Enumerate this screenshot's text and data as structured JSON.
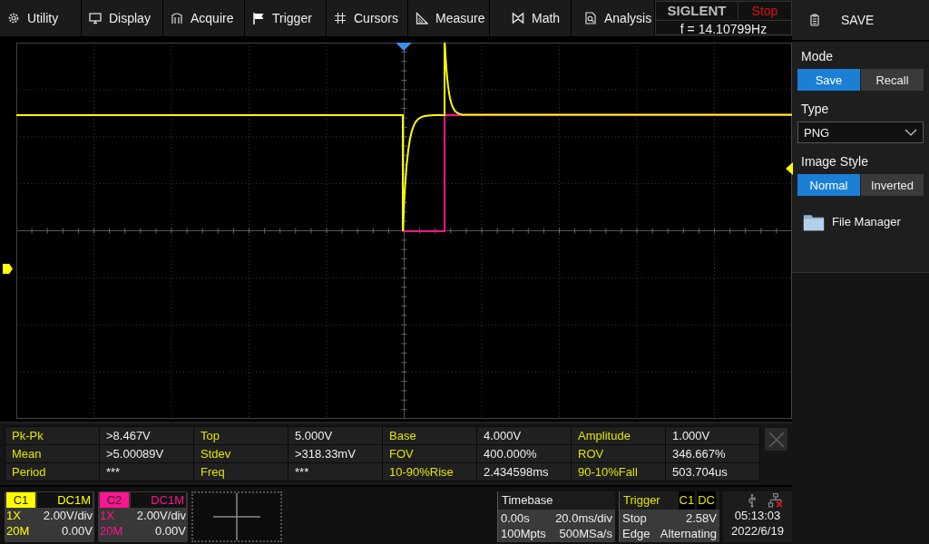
{
  "menu": [
    {
      "label": "Utility"
    },
    {
      "label": "Display"
    },
    {
      "label": "Acquire"
    },
    {
      "label": "Trigger"
    },
    {
      "label": "Cursors"
    },
    {
      "label": "Measure"
    },
    {
      "label": "Math"
    },
    {
      "label": "Analysis"
    }
  ],
  "brand": "SIGLENT",
  "run_state": "Stop",
  "frequency": "f = 14.10799Hz",
  "side_panel": {
    "title": "SAVE",
    "sections": [
      {
        "kind": "toggle",
        "label": "Mode",
        "options": [
          {
            "label": "Save",
            "selected": true
          },
          {
            "label": "Recall",
            "selected": false
          }
        ]
      },
      {
        "kind": "dropdown",
        "label": "Type",
        "value": "PNG"
      },
      {
        "kind": "toggle",
        "label": "Image Style",
        "options": [
          {
            "label": "Normal",
            "selected": true
          },
          {
            "label": "Inverted",
            "selected": false
          }
        ]
      },
      {
        "kind": "link",
        "label": "File Manager"
      }
    ]
  },
  "measurements": [
    [
      {
        "name": "Pk-Pk",
        "value": ">8.467V"
      },
      {
        "name": "Top",
        "value": "5.000V"
      },
      {
        "name": "Base",
        "value": "4.000V"
      },
      {
        "name": "Amplitude",
        "value": "1.000V"
      }
    ],
    [
      {
        "name": "Mean",
        "value": ">5.00089V"
      },
      {
        "name": "Stdev",
        "value": ">318.33mV"
      },
      {
        "name": "FOV",
        "value": "400.000%"
      },
      {
        "name": "ROV",
        "value": "346.667%"
      }
    ],
    [
      {
        "name": "Period",
        "value": "***"
      },
      {
        "name": "Freq",
        "value": "***"
      },
      {
        "name": "10-90%Rise",
        "value": "2.434598ms"
      },
      {
        "name": "90-10%Fall",
        "value": "503.704us"
      }
    ]
  ],
  "channels": [
    {
      "label": "C1",
      "coupling": "DC1M",
      "probe": "1X",
      "scale": "2.00V/div",
      "bandwidth": "20M",
      "offset": "0.00V",
      "color": "#ffff00"
    },
    {
      "label": "C2",
      "coupling": "DC1M",
      "probe": "1X",
      "scale": "2.00V/div",
      "bandwidth": "20M",
      "offset": "0.00V",
      "color": "#ff1493"
    }
  ],
  "timebase": {
    "title": "Timebase",
    "delay": "0.00s",
    "scale": "20.0ms/div",
    "memory": "100Mpts",
    "sample_rate": "500MSa/s"
  },
  "trigger": {
    "title": "Trigger",
    "source": "C1",
    "coupling": "DC",
    "state": "Stop",
    "level": "2.58V",
    "type": "Edge",
    "mode": "Alternating"
  },
  "clock": {
    "time": "05:13:03",
    "date": "2022/6/19"
  }
}
